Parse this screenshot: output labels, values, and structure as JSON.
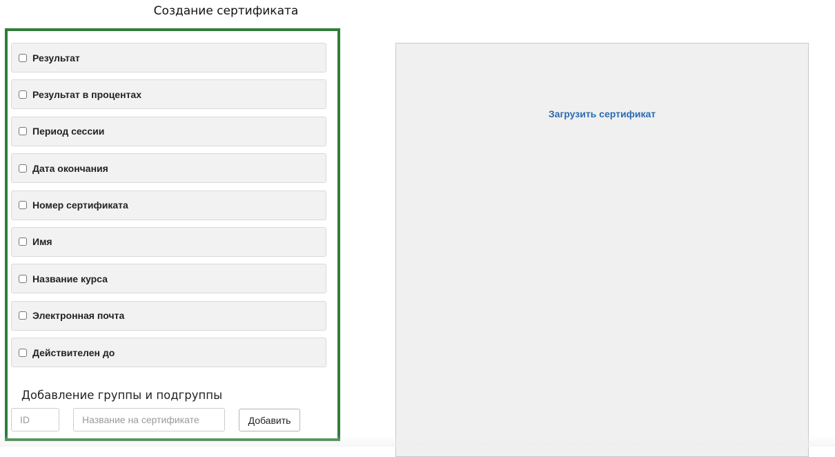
{
  "page": {
    "title": "Создание сертификата"
  },
  "fields": {
    "items": [
      {
        "label": "Результат",
        "checked": false
      },
      {
        "label": "Результат в процентах",
        "checked": false
      },
      {
        "label": "Период сессии",
        "checked": false
      },
      {
        "label": "Дата окончания",
        "checked": false
      },
      {
        "label": "Номер сертификата",
        "checked": false
      },
      {
        "label": "Имя",
        "checked": false
      },
      {
        "label": "Название курса",
        "checked": false
      },
      {
        "label": "Электронная почта",
        "checked": false
      },
      {
        "label": "Действителен до",
        "checked": false
      }
    ]
  },
  "group": {
    "title": "Добавление группы и подгруппы",
    "id_placeholder": "ID",
    "id_value": "",
    "name_placeholder": "Название на сертификате",
    "name_value": "",
    "add_label": "Добавить"
  },
  "upload": {
    "link_label": "Загрузить сертификат"
  },
  "colors": {
    "panel_border": "#2e7d3a",
    "link": "#2a6bb0",
    "row_background": "#f2f2f2",
    "upload_background": "#f0f0f0"
  }
}
